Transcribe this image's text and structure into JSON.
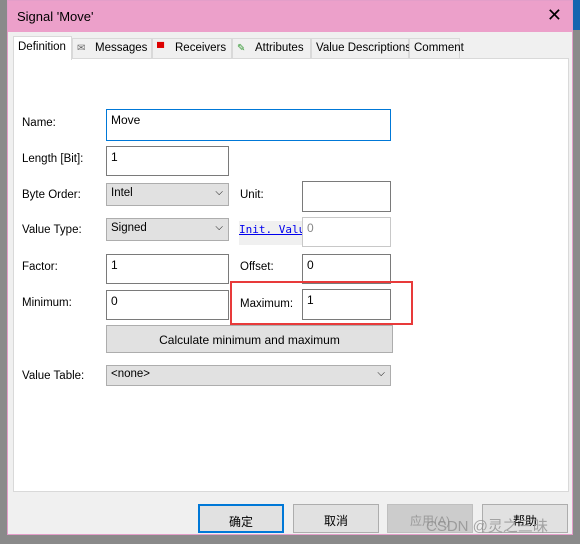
{
  "window": {
    "title": "Signal 'Move'"
  },
  "tabs": [
    {
      "label": "Definition",
      "icon": ""
    },
    {
      "label": "Messages",
      "icon": "envelope-icon"
    },
    {
      "label": "Receivers",
      "icon": "receiver-icon"
    },
    {
      "label": "Attributes",
      "icon": "attributes-pencil-icon"
    },
    {
      "label": "Value Descriptions",
      "icon": ""
    },
    {
      "label": "Comment",
      "icon": ""
    }
  ],
  "form": {
    "name_label": "Name:",
    "name_value": "Move",
    "length_label": "Length [Bit]:",
    "length_value": "1",
    "byte_order_label": "Byte Order:",
    "byte_order_value": "Intel",
    "unit_label": "Unit:",
    "unit_value": "",
    "value_type_label": "Value Type:",
    "value_type_value": "Signed",
    "init_value_label": "Init. Value",
    "init_value_value": "0",
    "factor_label": "Factor:",
    "factor_value": "1",
    "offset_label": "Offset:",
    "offset_value": "0",
    "minimum_label": "Minimum:",
    "minimum_value": "0",
    "maximum_label": "Maximum:",
    "maximum_value": "1",
    "calculate_label": "Calculate minimum and maximum",
    "value_table_label": "Value Table:",
    "value_table_value": "<none>"
  },
  "buttons": {
    "ok": "确定",
    "cancel": "取消",
    "apply": "应用(A)",
    "help": "帮助"
  },
  "watermark": "CSDN @灵之三昧",
  "colors": {
    "titlebar": "#eca0ca",
    "highlight": "#e83a3a",
    "focus": "#0078d7",
    "link": "#0000ee"
  }
}
